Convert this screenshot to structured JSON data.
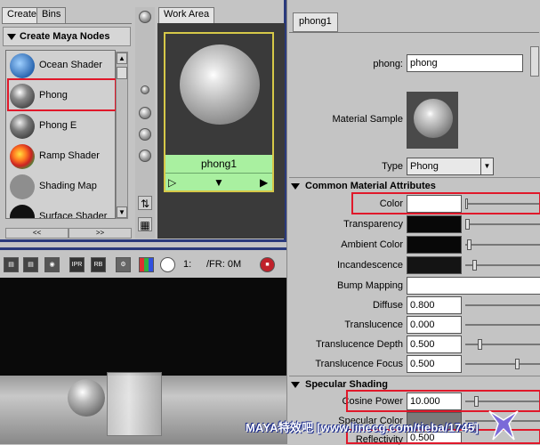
{
  "hypershade": {
    "tabs": [
      "Create",
      "Bins"
    ],
    "create_header": "Create Maya Nodes",
    "nodes": [
      {
        "label": "Ocean Shader",
        "color": "#2a66b0"
      },
      {
        "label": "Phong",
        "color": "#444444"
      },
      {
        "label": "Phong E",
        "color": "#555555"
      },
      {
        "label": "Ramp Shader",
        "color": "#cc3322"
      },
      {
        "label": "Shading Map",
        "color": "#8e8e8e"
      },
      {
        "label": "Surface Shader",
        "color": "#111111"
      }
    ],
    "scroll_left": "<<",
    "scroll_right": ">>",
    "work_area_tab": "Work Area",
    "swatch_name": "phong1",
    "swatch_ctrl_left": "▷",
    "swatch_ctrl_mid": "▼",
    "swatch_ctrl_right": "▶"
  },
  "render_view": {
    "toolbar_text_1": "1:",
    "toolbar_text_2": "/FR: 0M",
    "icon_labels": [
      "IPR",
      "RB"
    ]
  },
  "attribute_editor": {
    "tab": "phong1",
    "phong_label": "phong:",
    "phong_value": "phong",
    "material_sample_label": "Material Sample",
    "type_label": "Type",
    "type_value": "Phong",
    "section_common": "Common Material Attributes",
    "section_specular": "Specular Shading",
    "attrs": {
      "color": "Color",
      "transparency": "Transparency",
      "ambient": "Ambient Color",
      "incandescence": "Incandescence",
      "bump": "Bump Mapping",
      "diffuse": "Diffuse",
      "diffuse_val": "0.800",
      "translucence": "Translucence",
      "translucence_val": "0.000",
      "trans_depth": "Translucence Depth",
      "trans_depth_val": "0.500",
      "trans_focus": "Translucence Focus",
      "trans_focus_val": "0.500",
      "cosine": "Cosine Power",
      "cosine_val": "10.000",
      "spec_color": "Specular Color",
      "reflectivity": "Reflectivity",
      "reflectivity_val": "0.500"
    }
  },
  "watermark": "MAYA特效吧  [www.linecg.com/tieba/1745]",
  "colors": {
    "highlight": "#e0182a",
    "swatch_bar": "#a9f0a0",
    "frame_blue": "#2a3a7c"
  }
}
